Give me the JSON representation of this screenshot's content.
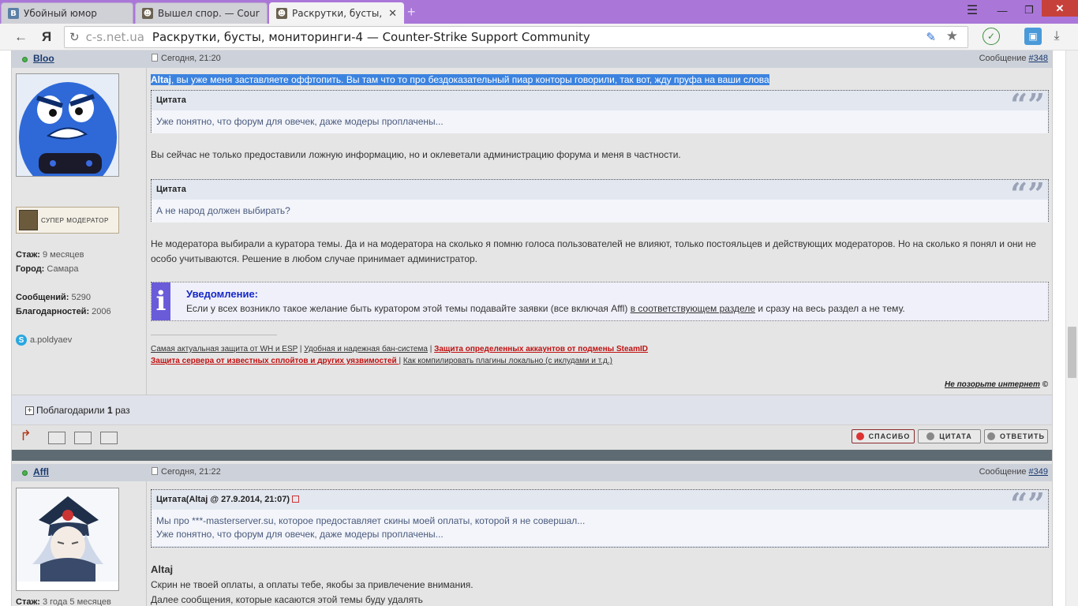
{
  "browser": {
    "tabs": [
      {
        "label": "Убойный юмор",
        "favicon": "vk-icon"
      },
      {
        "label": "Вышел спор. — Cour",
        "favicon": "cs-icon"
      },
      {
        "label": "Раскрутки, бусты, мо",
        "favicon": "cs-icon",
        "active": true
      }
    ],
    "address": {
      "domain": "c-s.net.ua",
      "title": "Раскрутки, бусты, мониторинги-4 — Counter-Strike Support Community"
    }
  },
  "posts": [
    {
      "author": "Bloo",
      "date": "Сегодня, 21:20",
      "message_label": "Сообщение ",
      "message_num": "#348",
      "rank": "СУПЕР МОДЕРАТОР",
      "info": {
        "staz_label": "Стаж:",
        "staz": " 9 месяцев",
        "city_label": "Город:",
        "city": " Самара",
        "msgs_label": "Сообщений:",
        "msgs": " 5290",
        "thx_label": "Благодарностей:",
        "thx": " 2006",
        "skype": "a.poldyaev"
      },
      "intro_name": "Altaj",
      "intro_text": ", вы уже меня заставляете оффтопить. Вы там что то про бездоказательный пиар конторы говорили, так вот, жду пруфа на ваши слова",
      "quotes": [
        {
          "header": "Цитата",
          "text": "Уже понятно, что форум для овечек, даже модеры проплачены..."
        },
        {
          "header": "Цитата",
          "text": "А не народ должен выбирать?"
        }
      ],
      "para1": "Вы сейчас не только предоставили ложную информацию, но и оклеветали администрацию форума и меня в частности.",
      "para2": "Не модератора выбирали а куратора темы. Да и на модератора на сколько я помню голоса пользователей не влияют, только постояльцев и действующих модераторов. Но на сколько я понял и они не особо учитываются. Решение в любом случае принимает администратор.",
      "notice": {
        "title": "Уведомление:",
        "text_before": "Если у всех возникло такое желание быть куратором этой темы подавайте заявки (все включая Affl) ",
        "link": "в соответствующем разделе",
        "text_after": " и сразу на весь раздел а не тему."
      },
      "signature": {
        "l1a": "Самая актуальная защита от WH и ESP",
        "sep": " | ",
        "l1b": "Удобная и надежная бан-система",
        "l1c": "Защита определенных аккаунтов от подмены SteamID ",
        "l2a": "Защита сервера от известных сплойтов и других уязвимостей ",
        "l2b": "Как компилировать плагины локально (с иклудами и т.д.)"
      },
      "footer_link": "Не позорьте интернет",
      "footer_copy": " ©",
      "thanks": {
        "prefix": "Поблагодарили ",
        "count": "1",
        "suffix": " раз"
      },
      "buttons": {
        "thanks": "СПАСИБО",
        "quote": "ЦИТАТА",
        "reply": "ОТВЕТИТЬ"
      }
    },
    {
      "author": "Affl",
      "date": "Сегодня, 21:22",
      "message_label": "Сообщение ",
      "message_num": "#349",
      "staz_label": "Стаж:",
      "staz": " 3 года 5 месяцев",
      "quote_header": "Цитата(Altaj @ 27.9.2014, 21:07)",
      "quote_line1": "Мы про ***-masterserver.su, которое предоставляет скины моей оплаты, которой я не совершал...",
      "quote_line2": "Уже понятно, что форум для овечек, даже модеры проплачены...",
      "bold_name": "Altaj",
      "line1": "Скрин не твоей оплаты, а оплаты тебе, якобы за привлечение внимания.",
      "line2": "Далее сообщения, которые касаются этой темы буду удалять"
    }
  ]
}
